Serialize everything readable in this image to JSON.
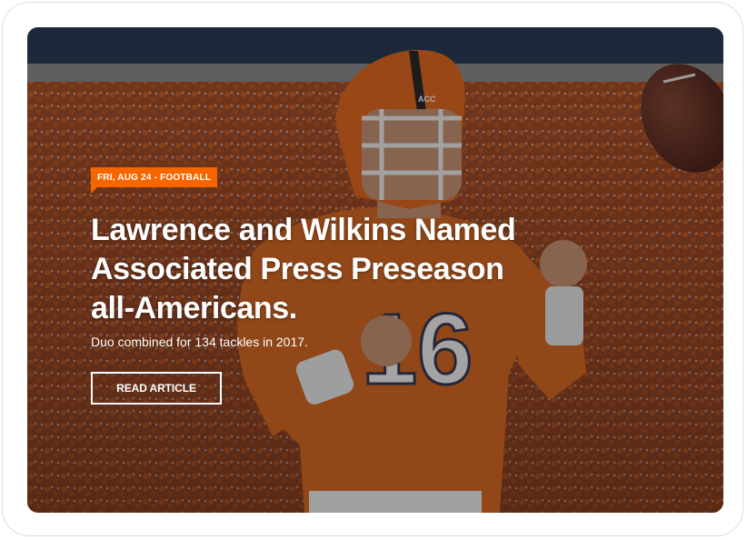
{
  "article": {
    "tag": "FRI, AUG 24 - FOOTBALL",
    "headline_lines": [
      "Lawrence and Wilkins Named",
      "Associated Press Preseason",
      "all-Americans."
    ],
    "subtitle": "Duo combined for 134 tackles in 2017.",
    "cta_label": "READ ARTICLE"
  },
  "photo": {
    "jersey_number": "16",
    "helmet_label": "ACC"
  },
  "colors": {
    "accent": "#f56600",
    "jersey": "#e06a1c",
    "crowd": "#b8552e",
    "overlay": "#000000"
  }
}
